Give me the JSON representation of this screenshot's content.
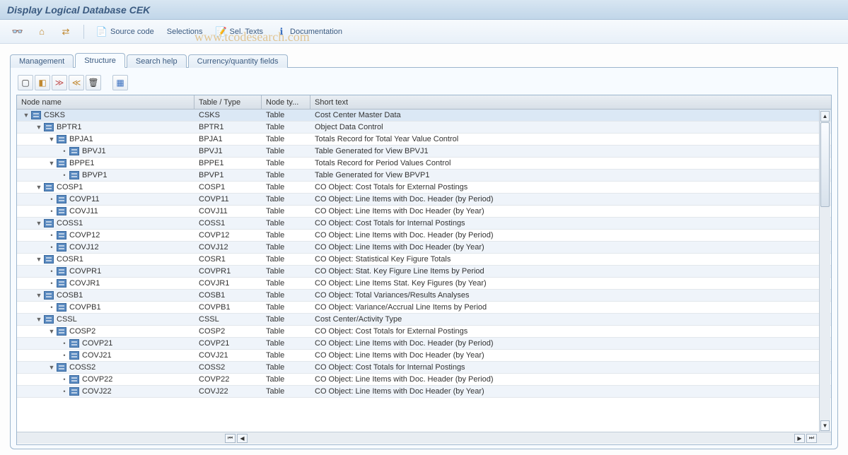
{
  "title": "Display Logical Database CEK",
  "toolbar": {
    "source_code": "Source code",
    "selections": "Selections",
    "sel_texts": "Sel. Texts",
    "documentation": "Documentation"
  },
  "tabs": {
    "management": "Management",
    "structure": "Structure",
    "search_help": "Search help",
    "currency": "Currency/quantity fields"
  },
  "columns": {
    "node_name": "Node name",
    "table_type": "Table / Type",
    "node_ty": "Node ty...",
    "short_text": "Short text"
  },
  "rows": [
    {
      "indent": 0,
      "toggle": "▼",
      "name": "CSKS",
      "table": "CSKS",
      "ntype": "Table",
      "short": "Cost Center Master Data",
      "highlight": true
    },
    {
      "indent": 1,
      "toggle": "▼",
      "name": "BPTR1",
      "table": "BPTR1",
      "ntype": "Table",
      "short": "Object Data                                Control"
    },
    {
      "indent": 2,
      "toggle": "▼",
      "name": "BPJA1",
      "table": "BPJA1",
      "ntype": "Table",
      "short": "Totals Record for Total Year Value          Control"
    },
    {
      "indent": 3,
      "toggle": "•",
      "name": "BPVJ1",
      "table": "BPVJ1",
      "ntype": "Table",
      "short": "Table Generated for View BPVJ1"
    },
    {
      "indent": 2,
      "toggle": "▼",
      "name": "BPPE1",
      "table": "BPPE1",
      "ntype": "Table",
      "short": "Totals Record for Period Values            Control"
    },
    {
      "indent": 3,
      "toggle": "•",
      "name": "BPVP1",
      "table": "BPVP1",
      "ntype": "Table",
      "short": "Table Generated for View BPVP1"
    },
    {
      "indent": 1,
      "toggle": "▼",
      "name": "COSP1",
      "table": "COSP1",
      "ntype": "Table",
      "short": "CO Object: Cost Totals for External Postings"
    },
    {
      "indent": 2,
      "toggle": "•",
      "name": "COVP11",
      "table": "COVP11",
      "ntype": "Table",
      "short": "CO Object: Line Items with Doc. Header (by Period)"
    },
    {
      "indent": 2,
      "toggle": "•",
      "name": "COVJ11",
      "table": "COVJ11",
      "ntype": "Table",
      "short": "CO Object: Line Items with Doc Header (by Year)"
    },
    {
      "indent": 1,
      "toggle": "▼",
      "name": "COSS1",
      "table": "COSS1",
      "ntype": "Table",
      "short": "CO Object: Cost Totals for Internal Postings"
    },
    {
      "indent": 2,
      "toggle": "•",
      "name": "COVP12",
      "table": "COVP12",
      "ntype": "Table",
      "short": "CO Object: Line Items with Doc. Header (by Period)"
    },
    {
      "indent": 2,
      "toggle": "•",
      "name": "COVJ12",
      "table": "COVJ12",
      "ntype": "Table",
      "short": "CO Object: Line Items with Doc Header (by Year)"
    },
    {
      "indent": 1,
      "toggle": "▼",
      "name": "COSR1",
      "table": "COSR1",
      "ntype": "Table",
      "short": "CO Object: Statistical Key Figure Totals"
    },
    {
      "indent": 2,
      "toggle": "•",
      "name": "COVPR1",
      "table": "COVPR1",
      "ntype": "Table",
      "short": "CO Object: Stat. Key Figure Line Items by Period"
    },
    {
      "indent": 2,
      "toggle": "•",
      "name": "COVJR1",
      "table": "COVJR1",
      "ntype": "Table",
      "short": "CO Object: Line Items Stat. Key Figures (by Year)"
    },
    {
      "indent": 1,
      "toggle": "▼",
      "name": "COSB1",
      "table": "COSB1",
      "ntype": "Table",
      "short": "CO Object: Total Variances/Results Analyses"
    },
    {
      "indent": 2,
      "toggle": "•",
      "name": "COVPB1",
      "table": "COVPB1",
      "ntype": "Table",
      "short": "CO Object: Variance/Accrual Line Items by Period"
    },
    {
      "indent": 1,
      "toggle": "▼",
      "name": "CSSL",
      "table": "CSSL",
      "ntype": "Table",
      "short": "Cost Center/Activity Type"
    },
    {
      "indent": 2,
      "toggle": "▼",
      "name": "COSP2",
      "table": "COSP2",
      "ntype": "Table",
      "short": "CO Object: Cost Totals for External Postings"
    },
    {
      "indent": 3,
      "toggle": "•",
      "name": "COVP21",
      "table": "COVP21",
      "ntype": "Table",
      "short": "CO Object: Line Items with Doc. Header (by Period)"
    },
    {
      "indent": 3,
      "toggle": "•",
      "name": "COVJ21",
      "table": "COVJ21",
      "ntype": "Table",
      "short": "CO Object: Line Items with Doc Header (by Year)"
    },
    {
      "indent": 2,
      "toggle": "▼",
      "name": "COSS2",
      "table": "COSS2",
      "ntype": "Table",
      "short": "CO Object: Cost Totals for Internal Postings"
    },
    {
      "indent": 3,
      "toggle": "•",
      "name": "COVP22",
      "table": "COVP22",
      "ntype": "Table",
      "short": "CO Object: Line Items with Doc. Header (by Period)"
    },
    {
      "indent": 3,
      "toggle": "•",
      "name": "COVJ22",
      "table": "COVJ22",
      "ntype": "Table",
      "short": "CO Object: Line Items with Doc Header (by Year)"
    }
  ]
}
